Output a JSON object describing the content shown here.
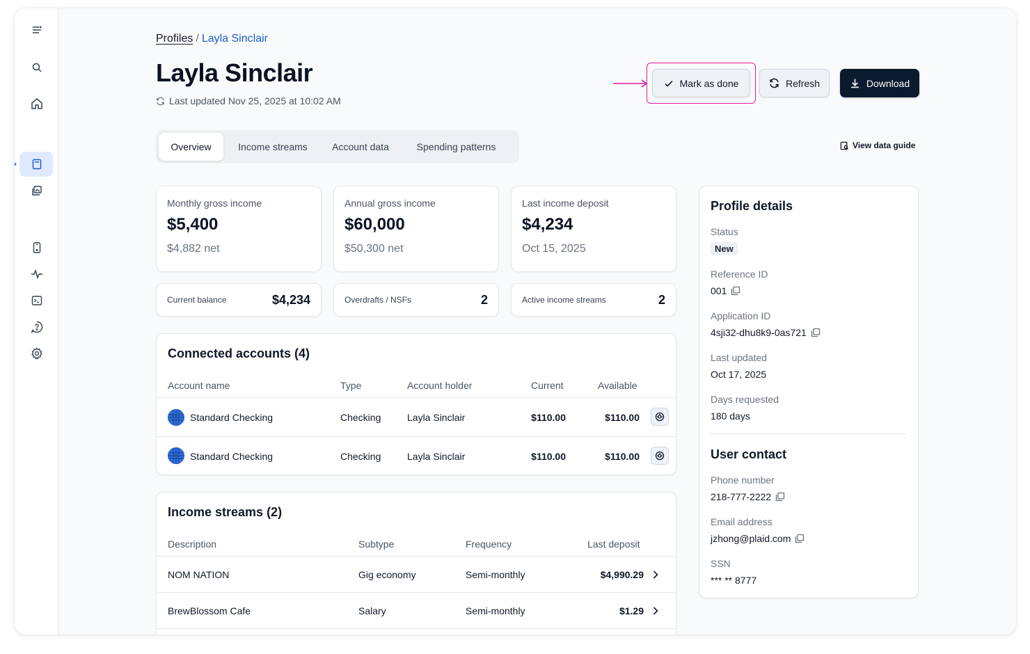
{
  "breadcrumb": {
    "root": "Profiles",
    "separator": "/",
    "current": "Layla Sinclair"
  },
  "header": {
    "title": "Layla Sinclair",
    "updated": "Last updated Nov 25, 2025 at 10:02 AM"
  },
  "actions": {
    "mark_done": "Mark as done",
    "refresh": "Refresh",
    "download": "Download"
  },
  "tabs": [
    {
      "label": "Overview",
      "active": true
    },
    {
      "label": "Income streams"
    },
    {
      "label": "Account data"
    },
    {
      "label": "Spending patterns"
    }
  ],
  "data_guide": "View data guide",
  "stats": [
    {
      "label": "Monthly gross income",
      "value": "$5,400",
      "sub": "$4,882 net"
    },
    {
      "label": "Annual gross income",
      "value": "$60,000",
      "sub": "$50,300 net"
    },
    {
      "label": "Last income deposit",
      "value": "$4,234",
      "sub": "Oct 15, 2025"
    }
  ],
  "mini_stats": [
    {
      "label": "Current balance",
      "value": "$4,234"
    },
    {
      "label": "Overdrafts / NSFs",
      "value": "2"
    },
    {
      "label": "Active income streams",
      "value": "2"
    }
  ],
  "accounts": {
    "title": "Connected accounts (4)",
    "columns": [
      "Account name",
      "Type",
      "Account holder",
      "Current",
      "Available"
    ],
    "rows": [
      {
        "name": "Standard Checking",
        "type": "Checking",
        "holder": "Layla Sinclair",
        "current": "$110.00",
        "available": "$110.00"
      },
      {
        "name": "Standard Checking",
        "type": "Checking",
        "holder": "Layla Sinclair",
        "current": "$110.00",
        "available": "$110.00"
      }
    ]
  },
  "income": {
    "title": "Income streams (2)",
    "columns": [
      "Description",
      "Subtype",
      "Frequency",
      "Last deposit"
    ],
    "rows": [
      {
        "description": "NOM NATION",
        "subtype": "Gig economy",
        "frequency": "Semi-monthly",
        "last": "$4,990.29"
      },
      {
        "description": "BrewBlossom Cafe",
        "subtype": "Salary",
        "frequency": "Semi-monthly",
        "last": "$1.29"
      }
    ]
  },
  "profile": {
    "title": "Profile details",
    "status_label": "Status",
    "status": "New",
    "ref_label": "Reference ID",
    "ref": "001",
    "app_label": "Application ID",
    "app": "4sji32-dhu8k9-0as721",
    "updated_label": "Last updated",
    "updated": "Oct 17, 2025",
    "days_label": "Days requested",
    "days": "180 days",
    "contact_title": "User contact",
    "phone_label": "Phone number",
    "phone": "218-777-2222",
    "email_label": "Email address",
    "email": "jzhong@plaid.com",
    "ssn_label": "SSN",
    "ssn": "*** ** 8777"
  },
  "colors": {
    "accent": "#1d5fc9",
    "primary_button": "#0b1a2e",
    "callout": "#e11d9b",
    "active_nav": "#e0eaff"
  },
  "sidebar_icons": [
    "menu-icon",
    "search-icon",
    "home-icon",
    "profile-icon",
    "gallery-icon",
    "device-icon",
    "activity-icon",
    "terminal-icon",
    "help-icon",
    "settings-icon"
  ]
}
